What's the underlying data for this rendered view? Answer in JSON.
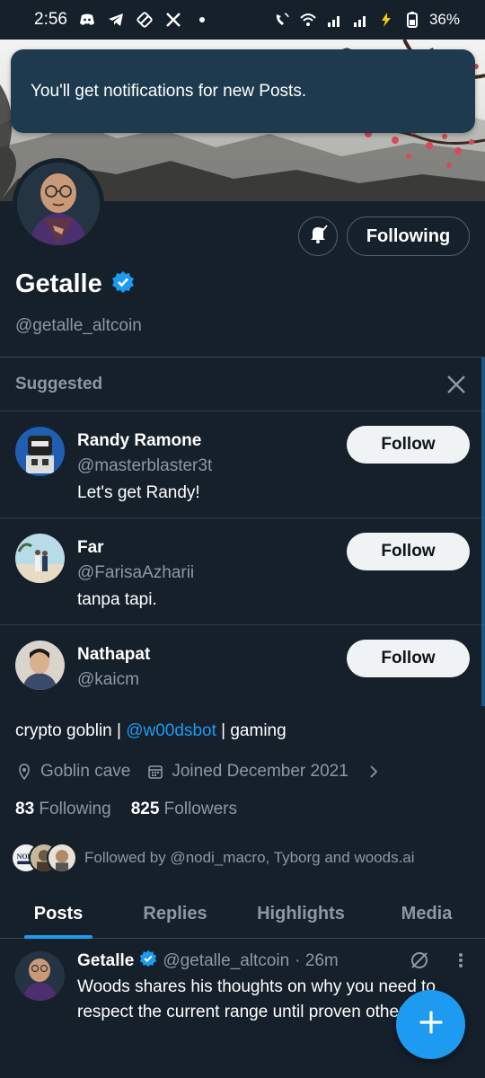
{
  "status_bar": {
    "time": "2:56",
    "battery": "36%"
  },
  "toast": {
    "message": "You'll get notifications for new Posts."
  },
  "profile": {
    "name": "Getalle",
    "handle": "@getalle_altcoin",
    "following_button": "Following",
    "bio_prefix": "crypto goblin | ",
    "bio_mention": "@w00dsbot",
    "bio_suffix": " | gaming",
    "location": "Goblin cave",
    "joined": "Joined December 2021",
    "following_count": "83",
    "following_label": "Following",
    "followers_count": "825",
    "followers_label": "Followers",
    "followed_by": "Followed by @nodi_macro, Tyborg and woods.ai",
    "fb_avatar_text": "NODI"
  },
  "suggested": {
    "header": "Suggested",
    "items": [
      {
        "name": "Randy Ramone",
        "handle": "@masterblaster3t",
        "bio": "Let's get Randy!",
        "button": "Follow"
      },
      {
        "name": "Far",
        "handle": "@FarisaAzharii",
        "bio": "tanpa tapi.",
        "button": "Follow"
      },
      {
        "name": "Nathapat",
        "handle": "@kaicm",
        "bio": "",
        "button": "Follow"
      }
    ]
  },
  "tabs": [
    {
      "label": "Posts",
      "active": true
    },
    {
      "label": "Replies",
      "active": false
    },
    {
      "label": "Highlights",
      "active": false
    },
    {
      "label": "Media",
      "active": false
    }
  ],
  "post": {
    "name": "Getalle",
    "handle": "@getalle_altcoin",
    "time": "· 26m",
    "text": "Woods shares his thoughts on why you need to respect the current range until proven otherwise:"
  },
  "colors": {
    "background": "#15202b",
    "accent": "#1d9bf0",
    "secondary_text": "#8b98a5"
  }
}
